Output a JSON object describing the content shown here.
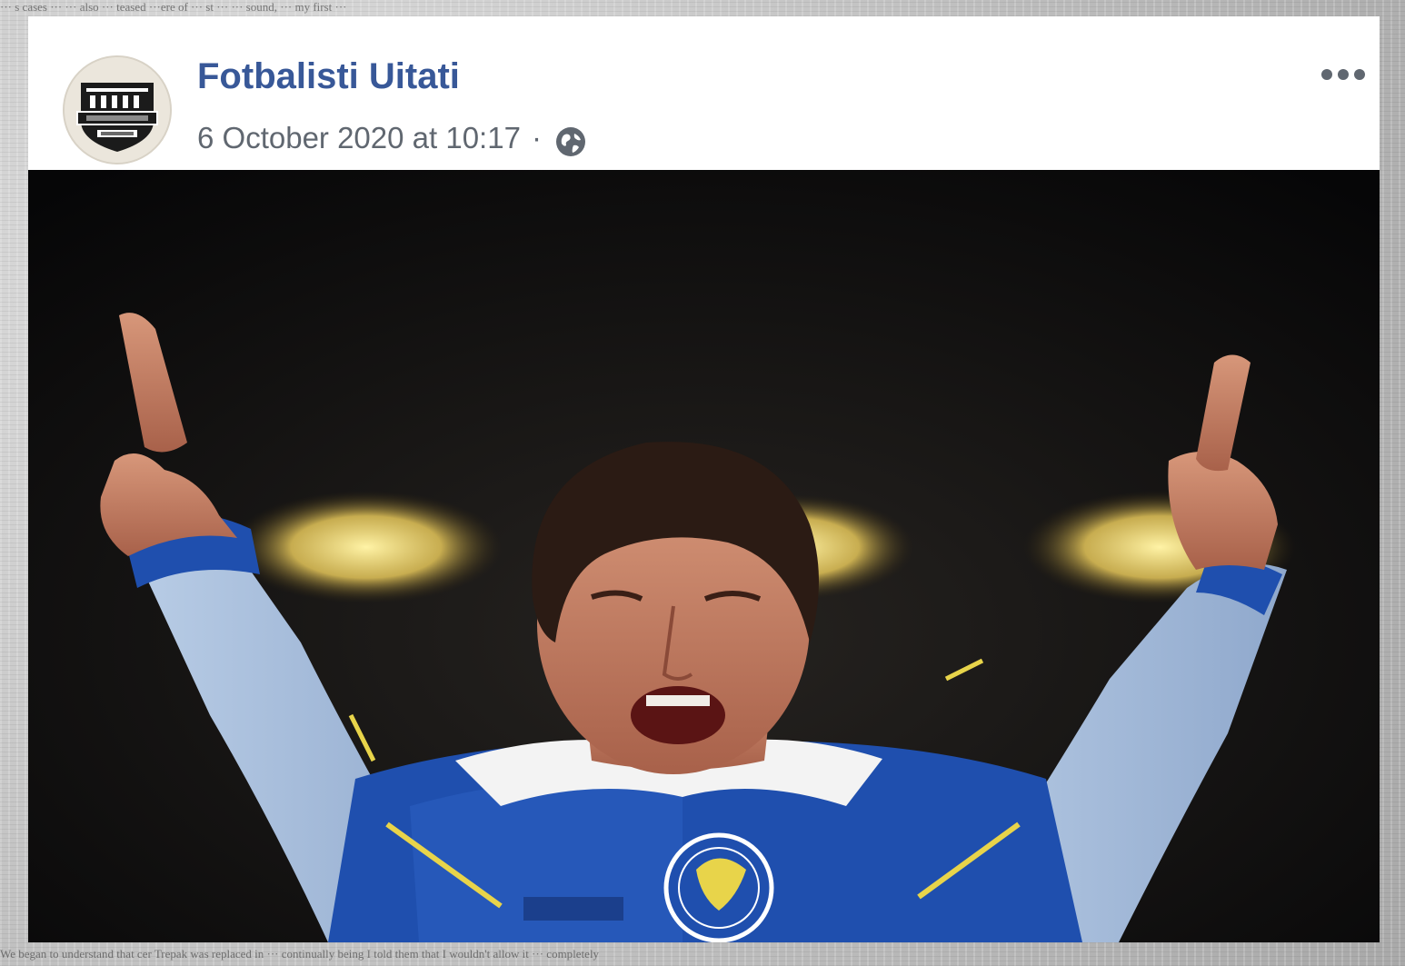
{
  "post": {
    "author": "Fotbalisti Uitati",
    "timestamp": "6 October 2020 at 10:17",
    "separator": "·",
    "audience_icon": "globe-icon",
    "more_icon": "more-options-icon",
    "avatar_icon": "page-logo-icon",
    "photo_icon": "football-player-celebrating-photo"
  },
  "background": {
    "top_fragment": "···  s      cases    ···     ··· also  ··· teased    ···ere of ··· st   ···       ··· sound,   ··· my  first    ···",
    "bottom_fragment": "We began to understand that cer    Trepak was replaced in    ···                    continually    being    I told them that I wouldn't allow it    ··· completely"
  },
  "colors": {
    "author_link": "#385898",
    "meta_text": "#606770",
    "card_background": "#ffffff",
    "jersey_blue": "#1f4fae",
    "jersey_yellow": "#e8d44a"
  }
}
